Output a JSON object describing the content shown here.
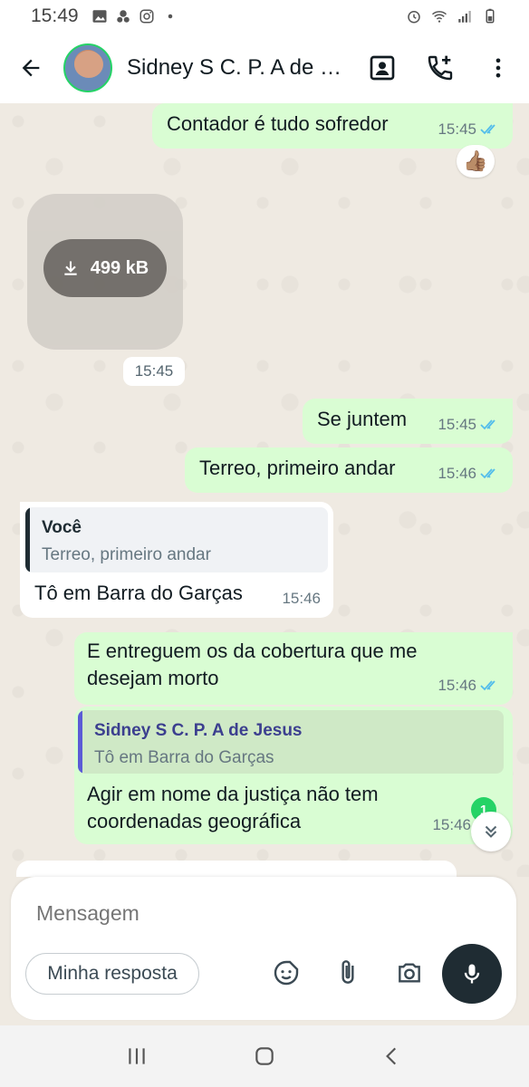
{
  "status_bar": {
    "time": "15:49"
  },
  "header": {
    "title": "Sidney S C. P. A de Jesus"
  },
  "messages": [
    {
      "text": "Contador é tudo sofredor",
      "time": "15:45",
      "reaction": "👍🏽"
    },
    {
      "size": "499 kB",
      "time": "15:45"
    },
    {
      "text": "Se juntem",
      "time": "15:45"
    },
    {
      "text": "Terreo, primeiro andar",
      "time": "15:46"
    },
    {
      "quote_name": "Você",
      "quote_text": "Terreo, primeiro andar",
      "text": "Tô em Barra do Garças",
      "time": "15:46"
    },
    {
      "text_line1": "E entreguem os da cobertura que me",
      "text_line2": "desejam morto",
      "time": "15:46"
    },
    {
      "quote_name": "Sidney S C. P. A de Jesus",
      "quote_text": "Tô em Barra do Garças",
      "text_line1": "Agir em nome da justiça não tem",
      "text_line2": "coordenadas geográfica",
      "time": "15:46"
    }
  ],
  "unread_count": "1",
  "composer": {
    "placeholder": "Mensagem",
    "quick_reply": "Minha resposta"
  },
  "colors": {
    "outgoing": "#d9fdd3",
    "incoming": "#ffffff",
    "accent": "#25d366",
    "read_ticks": "#53bdeb",
    "quote_bar_self": "#1f2c33",
    "quote_bar_other": "#5b5bd6"
  },
  "icons": [
    "back-arrow-icon",
    "contact-card-icon",
    "add-call-icon",
    "more-vert-icon",
    "download-icon",
    "double-check-icon",
    "chevron-double-down-icon",
    "sticker-icon",
    "attach-icon",
    "camera-icon",
    "mic-icon",
    "recents-icon",
    "home-icon",
    "back-nav-icon"
  ]
}
